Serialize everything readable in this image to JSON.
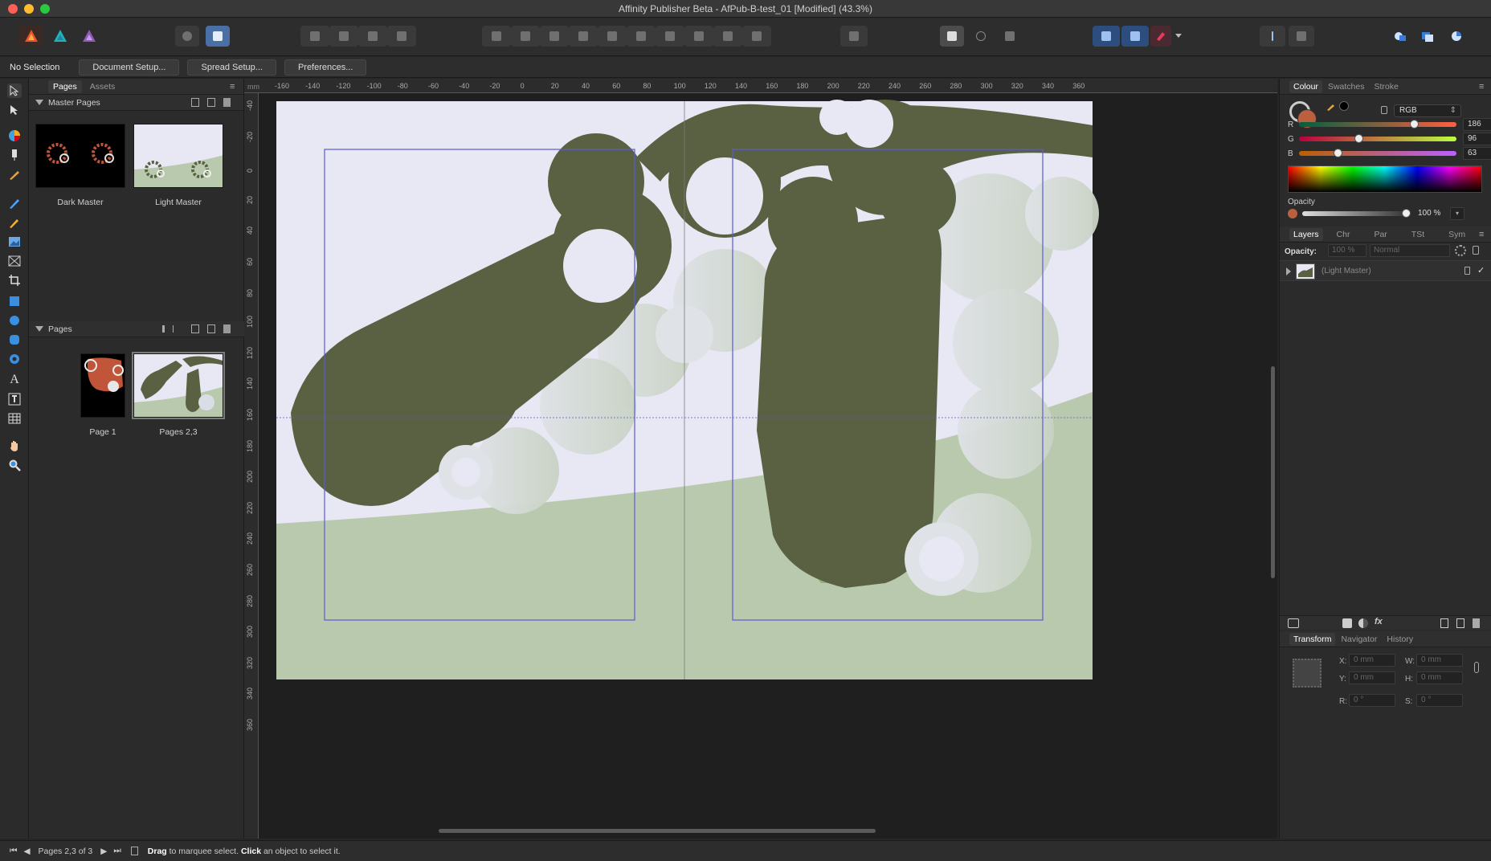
{
  "window": {
    "title": "Affinity Publisher Beta - AfPub-B-test_01 [Modified] (43.3%)"
  },
  "context_bar": {
    "selection": "No Selection",
    "buttons": [
      "Document Setup...",
      "Spread Setup...",
      "Preferences..."
    ]
  },
  "pages_panel": {
    "tabs": [
      "Pages",
      "Assets"
    ],
    "master_section": "Master Pages",
    "masters": [
      {
        "label": "Dark Master"
      },
      {
        "label": "Light Master"
      }
    ],
    "pages_section": "Pages",
    "pages": [
      {
        "label": "Page 1"
      },
      {
        "label": "Pages 2,3"
      }
    ]
  },
  "rulers": {
    "top_labels": [
      "-160",
      "-140",
      "-120",
      "-100",
      "-80",
      "-60",
      "-40",
      "-20",
      "0",
      "20",
      "40",
      "60",
      "80",
      "100",
      "120",
      "140",
      "160",
      "180",
      "200",
      "220",
      "240",
      "260",
      "280",
      "300",
      "320",
      "340",
      "360"
    ],
    "left_labels": [
      "-40",
      "-20",
      "0",
      "20",
      "40",
      "60",
      "80",
      "100",
      "120",
      "140",
      "160",
      "180",
      "200",
      "220",
      "240",
      "260",
      "280",
      "300",
      "320",
      "340",
      "360"
    ],
    "unit": "mm"
  },
  "colour_panel": {
    "tabs": [
      "Colour",
      "Swatches",
      "Stroke"
    ],
    "mode": "RGB",
    "r": "186",
    "g": "96",
    "b": "63",
    "channel_labels": [
      "R",
      "G",
      "B"
    ],
    "r_fraction": 0.73,
    "g_fraction": 0.376,
    "b_fraction": 0.247,
    "opacity_label": "Opacity",
    "opacity_value": "100 %",
    "fill_color": "#ba603f"
  },
  "layers_panel": {
    "tabs": [
      "Layers",
      "Chr",
      "Par",
      "TSt",
      "Sym"
    ],
    "opacity_label": "Opacity:",
    "opacity_value": "100 %",
    "blend_mode": "Normal",
    "layer_name": "(Light Master)"
  },
  "transform_panel": {
    "tabs": [
      "Transform",
      "Navigator",
      "History"
    ],
    "x_label": "X:",
    "x": "0 mm",
    "y_label": "Y:",
    "y": "0 mm",
    "w_label": "W:",
    "w": "0 mm",
    "h_label": "H:",
    "h": "0 mm",
    "r_label": "R:",
    "r": "0 °",
    "s_label": "S:",
    "s": "0 °"
  },
  "status_bar": {
    "page_indicator": "Pages 2,3 of 3",
    "hint_drag": "Drag",
    "hint_drag_text": " to marquee select. ",
    "hint_click": "Click",
    "hint_click_text": " an object to select it."
  },
  "colors": {
    "accent": "#4a90e2",
    "canvas_bg": "#e8e7f4",
    "olive": "#5a6143",
    "sage": "#b9c9ae",
    "margin_guide": "#5b5bd6"
  }
}
